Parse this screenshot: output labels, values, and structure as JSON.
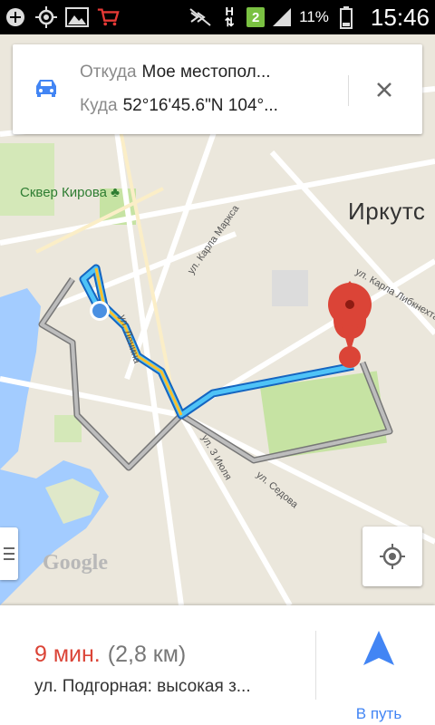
{
  "status_bar": {
    "time": "15:46",
    "battery_percent": "11%",
    "network_type": "H",
    "sim_badge": "2",
    "icons": [
      "plus-icon",
      "gps-icon",
      "image-icon",
      "cart-icon",
      "mute-icon",
      "network-h-icon",
      "sim-2-icon",
      "signal-icon",
      "battery-icon"
    ]
  },
  "route_card": {
    "from_label": "Откуда",
    "from_value": "Мое местопол...",
    "to_label": "Куда",
    "to_value": "52°16'45.6\"N 104°...",
    "mode_icon": "car-icon",
    "close_icon": "close-icon"
  },
  "map": {
    "city_label": "Иркутс",
    "park_label": "Сквер Кирова",
    "street_labels": {
      "karla_marksa": "ул. Карла Маркса",
      "karla_libknekhta": "ул. Карла Либкнехта",
      "lenina": "ул. Ленина",
      "iyulya": "ул. 3 Июля",
      "sedova": "ул. Седова"
    },
    "watermark": "Google",
    "route_color": "#2196f3",
    "alt_route_color": "#9e9e9e",
    "pin_color": "#db4437"
  },
  "bottom_sheet": {
    "eta_time": "9 мин.",
    "eta_distance": "(2,8 км)",
    "via": "ул. Подгорная: высокая з...",
    "go_label": "В путь"
  }
}
